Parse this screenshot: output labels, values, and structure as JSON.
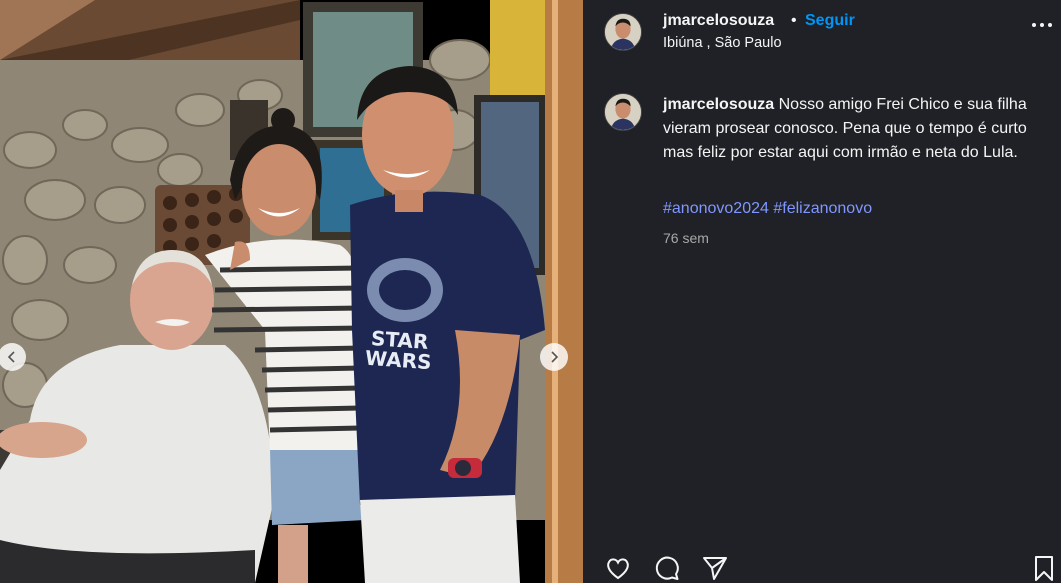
{
  "post": {
    "author": "jmarcelosouza",
    "dot": "•",
    "follow_label": "Seguir",
    "location": "Ibiúna , São Paulo",
    "caption": "Nosso amigo Frei Chico e sua filha vieram prosear conosco. Pena que o tempo é curto mas feliz por estar aqui com irmão e neta do Lula.",
    "hashtags": [
      "#anonovo2024",
      "#felizanonovo"
    ],
    "age": "76 sem"
  },
  "photo": {
    "shirt_logo_line1": "STAR",
    "shirt_logo_line2": "WARS"
  },
  "icons": {
    "more": "more-options-icon",
    "like": "heart-icon",
    "comment": "comment-icon",
    "share": "send-icon",
    "save": "bookmark-icon",
    "prev": "chevron-left-icon",
    "next": "chevron-right-icon"
  },
  "colors": {
    "panel_bg": "#202126",
    "follow": "#0095f6",
    "hashtag": "#7f97ff",
    "muted": "#a8a8a8"
  }
}
